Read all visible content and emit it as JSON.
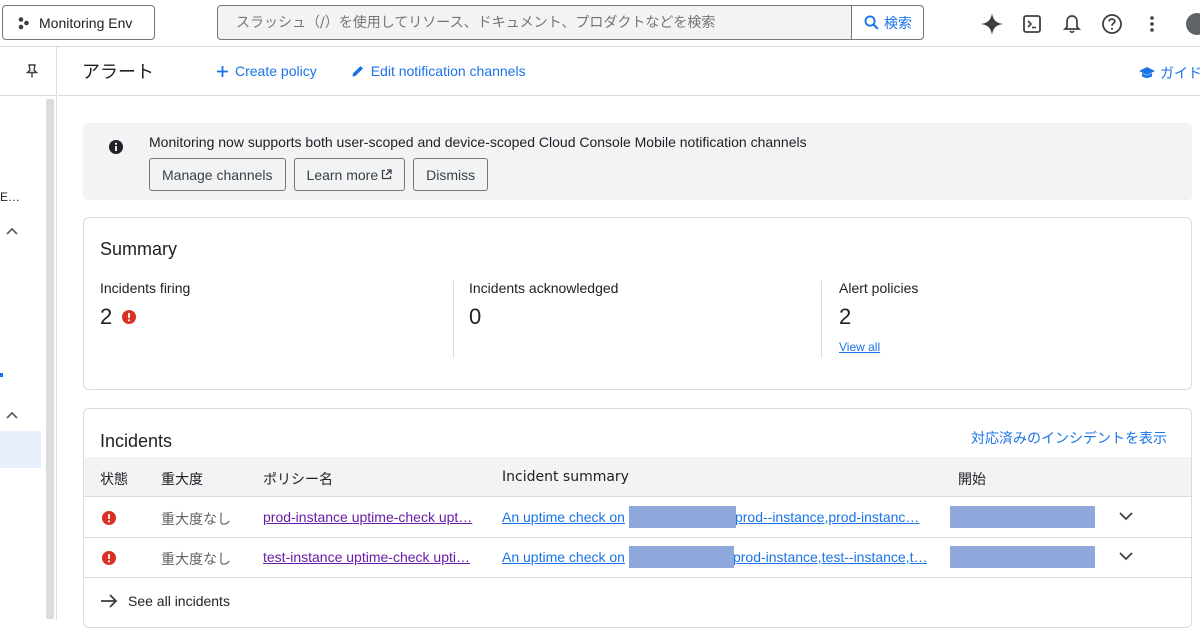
{
  "topbar": {
    "project_label": "Monitoring Env",
    "search_placeholder": "スラッシュ（/）を使用してリソース、ドキュメント、プロダクトなどを検索",
    "search_button_label": "検索"
  },
  "header": {
    "title": "アラート",
    "create_policy_label": "Create policy",
    "edit_channels_label": "Edit notification channels",
    "guide_label": "ガイド"
  },
  "nav": {
    "fragment_text": "E…"
  },
  "banner": {
    "message": "Monitoring now supports both user-scoped and device-scoped Cloud Console Mobile notification channels",
    "buttons": [
      "Manage channels",
      "Learn more",
      "Dismiss"
    ]
  },
  "summary": {
    "title": "Summary",
    "metrics": [
      {
        "label": "Incidents firing",
        "value": "2"
      },
      {
        "label": "Incidents acknowledged",
        "value": "0"
      },
      {
        "label": "Alert policies",
        "value": "2",
        "link": "View all"
      }
    ]
  },
  "incidents": {
    "title": "Incidents",
    "resolved_link": "対応済みのインシデントを表示",
    "columns": [
      "状態",
      "重大度",
      "ポリシー名",
      "Incident summary",
      "開始"
    ],
    "rows": [
      {
        "severity": "重大度なし",
        "policy": "prod-instance uptime-check upt…",
        "summary_start": "An uptime check on",
        "summary_end": "prod--instance,prod-instanc…"
      },
      {
        "severity": "重大度なし",
        "policy": "test-instance uptime-check upti…",
        "summary_start": "An uptime check on",
        "summary_end": "prod-instance,test--instance,t…"
      }
    ],
    "see_all_label": "See all incidents"
  },
  "colors": {
    "accent": "#1a73e8",
    "error": "#d93025",
    "visited_link": "#681da8",
    "redaction": "#8fa8dc"
  },
  "icons": {
    "project": "project-nodes-icon",
    "search": "search-icon",
    "gemini": "sparkle-icon",
    "shell": "cloud-shell-icon",
    "notifications": "bell-icon",
    "help": "help-icon",
    "more": "more-vert-icon",
    "pin": "pin-icon",
    "info": "info-icon",
    "error": "error-icon",
    "expand": "chevron-down-icon",
    "arrow": "arrow-right-icon"
  }
}
